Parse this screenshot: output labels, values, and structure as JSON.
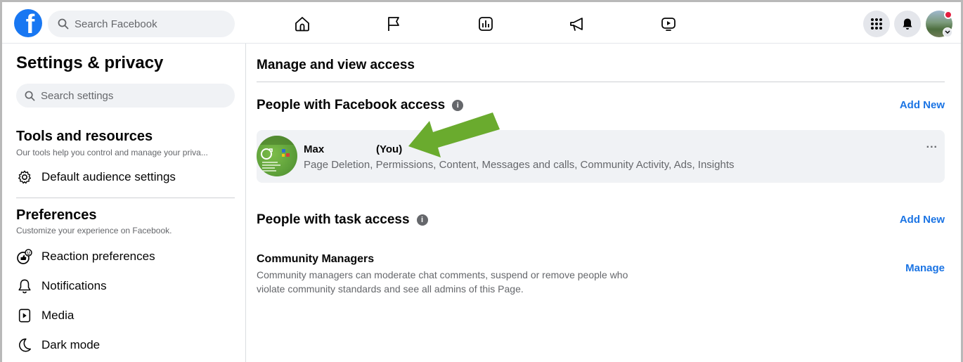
{
  "topbar": {
    "logo_letter": "f",
    "search_placeholder": "Search Facebook",
    "nav_icons": [
      "home-icon",
      "flag-icon",
      "insights-icon",
      "megaphone-icon",
      "video-icon"
    ],
    "right_icons": [
      "menu-grid-icon",
      "notifications-bell-icon",
      "profile-avatar"
    ]
  },
  "sidebar": {
    "title": "Settings & privacy",
    "search_placeholder": "Search settings",
    "tools": {
      "title": "Tools and resources",
      "subtitle": "Our tools help you control and manage your priva...",
      "items": [
        {
          "label": "Default audience settings",
          "icon": "gear-icon"
        }
      ]
    },
    "preferences": {
      "title": "Preferences",
      "subtitle": "Customize your experience on Facebook.",
      "items": [
        {
          "label": "Reaction preferences",
          "icon": "reaction-icon"
        },
        {
          "label": "Notifications",
          "icon": "bell-icon"
        },
        {
          "label": "Media",
          "icon": "media-icon"
        },
        {
          "label": "Dark mode",
          "icon": "moon-icon"
        }
      ]
    }
  },
  "main": {
    "title": "Manage and view access",
    "facebook_access": {
      "heading": "People with Facebook access",
      "add_label": "Add New",
      "person": {
        "name": "Max",
        "you_label": "(You)",
        "permissions": "Page Deletion, Permissions, Content, Messages and calls, Community Activity, Ads, Insights",
        "more_label": "..."
      }
    },
    "task_access": {
      "heading": "People with task access",
      "add_label": "Add New",
      "role": {
        "title": "Community Managers",
        "description": "Community managers can moderate chat comments, suspend or remove people who violate community standards and see all admins of this Page.",
        "action_label": "Manage"
      }
    }
  },
  "colors": {
    "brand": "#1877f2",
    "link": "#1b74e4",
    "annotation_arrow": "#6aab2e",
    "notification_dot": "#e41e3f"
  }
}
